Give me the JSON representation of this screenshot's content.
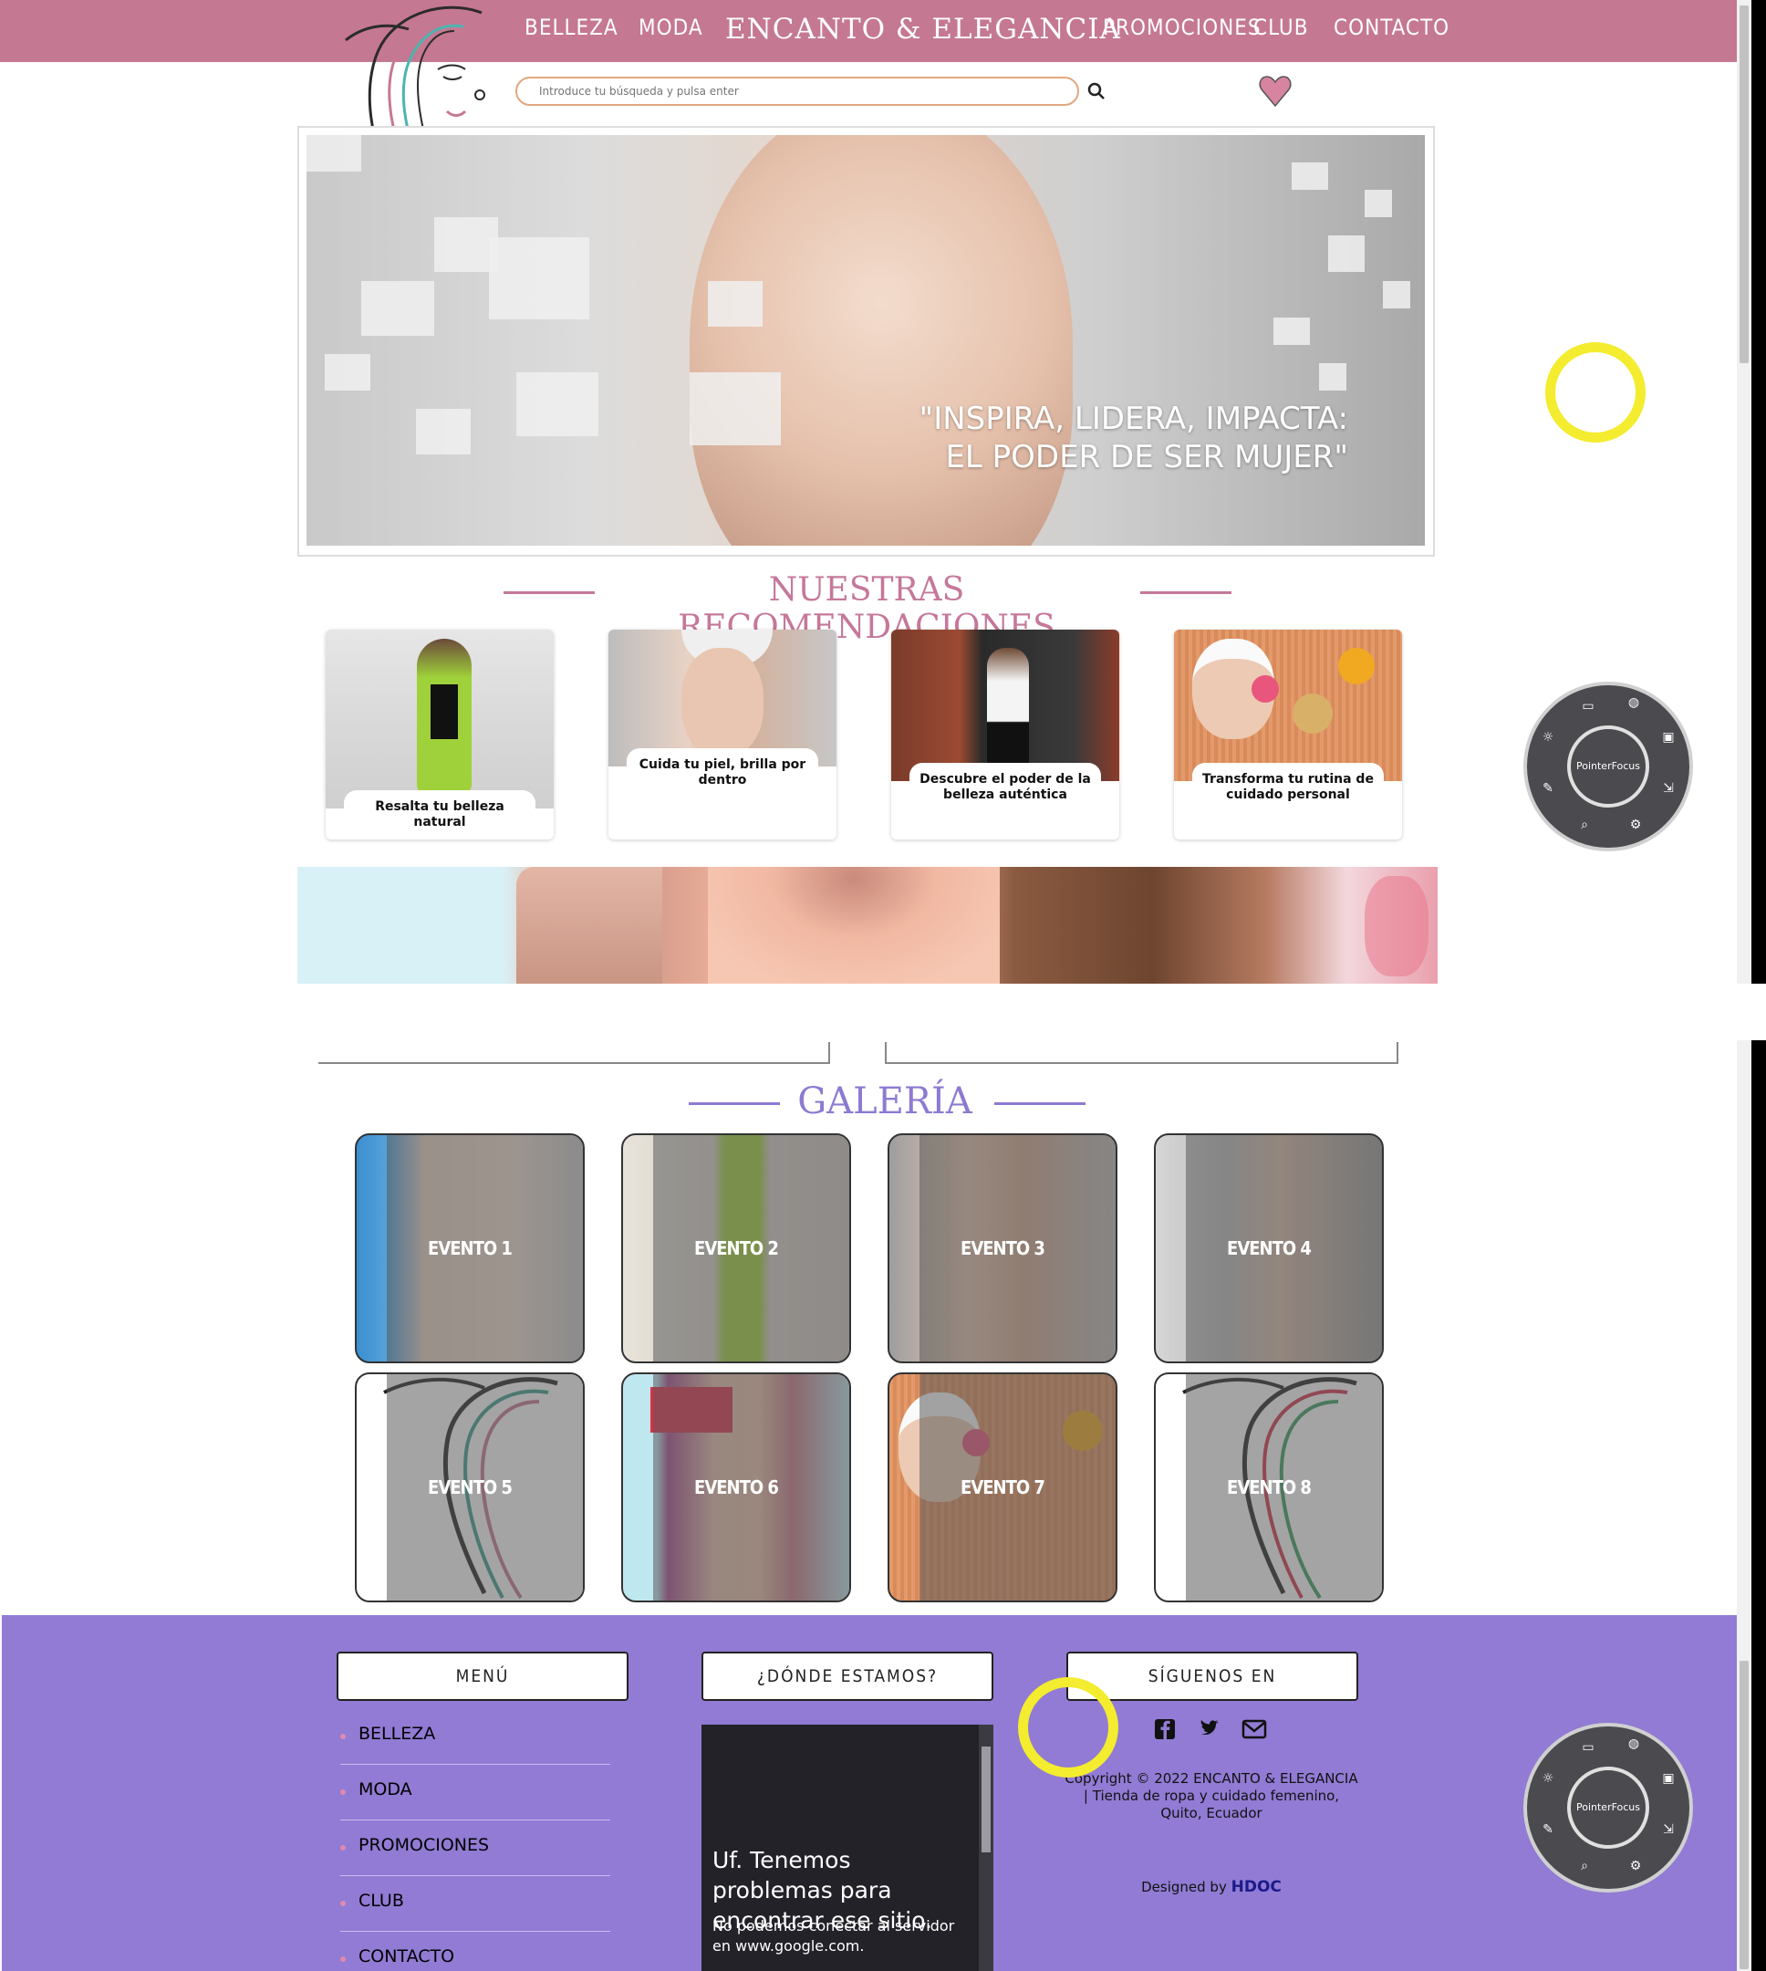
{
  "nav": {
    "left": [
      "BELLEZA",
      "MODA"
    ],
    "brand": "ENCANTO & ELEGANCIA",
    "right": [
      "PROMOCIONES",
      "CLUB",
      "CONTACTO"
    ]
  },
  "search": {
    "placeholder": "Introduce tu búsqueda y pulsa enter",
    "icon": "search-icon"
  },
  "hero": {
    "quote_line1": "\"INSPIRA, LIDERA, IMPACTA:",
    "quote_line2": "EL PODER DE SER MUJER\""
  },
  "recommendations": {
    "title": "NUESTRAS RECOMENDACIONES",
    "title_color": "#c5789a",
    "cards": [
      {
        "caption": "Resalta tu belleza natural"
      },
      {
        "caption": "Cuida tu piel, brilla por dentro"
      },
      {
        "caption": "Descubre el poder de la belleza auténtica"
      },
      {
        "caption": "Transforma tu rutina de cuidado personal"
      }
    ]
  },
  "gallery": {
    "title": "GALERÍA",
    "title_color": "#8d7ad2",
    "items": [
      "EVENTO 1",
      "EVENTO 2",
      "EVENTO 3",
      "EVENTO 4",
      "EVENTO 5",
      "EVENTO 6",
      "EVENTO 7",
      "EVENTO 8"
    ]
  },
  "footer": {
    "bg_color": "#917bd4",
    "menu_title": "MENÚ",
    "location_title": "¿DÓNDE ESTAMOS?",
    "follow_title": "SÍGUENOS EN",
    "menu_items": [
      "BELLEZA",
      "MODA",
      "PROMOCIONES",
      "CLUB",
      "CONTACTO"
    ],
    "map_error_title": "Uf. Tenemos problemas para encontrar ese sitio.",
    "map_error_text": "No podemos conectar al servidor en www.google.com.",
    "social_icons": [
      "facebook-icon",
      "twitter-icon",
      "mail-icon"
    ],
    "copyright": "Copyright © 2022 ENCANTO & ELEGANCIA | Tienda de ropa y cuidado femenino, Quito, Ecuador",
    "designed_prefix": "Designed by",
    "designed_by": "HDOC"
  },
  "pointerfocus": {
    "label": "PointerFocus"
  },
  "colors": {
    "nav_bg": "#c57892",
    "accent_pink": "#c5789a",
    "accent_purple": "#8d7ad2",
    "highlight_ring": "#f4ec2e"
  }
}
